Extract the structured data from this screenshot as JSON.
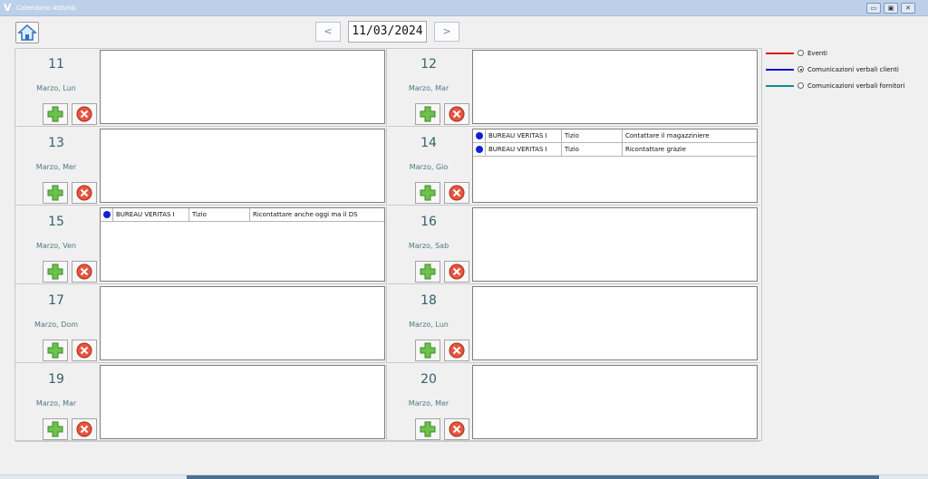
{
  "window": {
    "title": "Calendario Attività"
  },
  "toolbar": {
    "home_icon": "home-icon",
    "prev_label": "<",
    "next_label": ">",
    "date_value": "11/03/2024"
  },
  "days": [
    {
      "day": "11",
      "label": "Marzo, Lun",
      "events": []
    },
    {
      "day": "12",
      "label": "Marzo, Mar",
      "events": []
    },
    {
      "day": "13",
      "label": "Marzo, Mer",
      "events": []
    },
    {
      "day": "14",
      "label": "Marzo, Gio",
      "events": [
        {
          "client": "BUREAU VERITAS I",
          "user": "Tizio",
          "note": "Contattare il magazziniere"
        },
        {
          "client": "BUREAU VERITAS I",
          "user": "Tizio",
          "note": "Ricontattare grazie"
        }
      ]
    },
    {
      "day": "15",
      "label": "Marzo, Ven",
      "events": [
        {
          "client": "BUREAU VERITAS I",
          "user": "Tizio",
          "note": "Ricontattare anche oggi ma il DS"
        }
      ]
    },
    {
      "day": "16",
      "label": "Marzo, Sab",
      "events": []
    },
    {
      "day": "17",
      "label": "Marzo, Dom",
      "events": []
    },
    {
      "day": "18",
      "label": "Marzo, Lun",
      "events": []
    },
    {
      "day": "19",
      "label": "Marzo, Mar",
      "events": []
    },
    {
      "day": "20",
      "label": "Marzo, Mer",
      "events": []
    }
  ],
  "legend": [
    {
      "label": "Eventi",
      "color": "#e01010",
      "selected": false
    },
    {
      "label": "Comunicazioni verbali clienti",
      "color": "#1010d0",
      "selected": true
    },
    {
      "label": "Comunicazioni verbali fornitori",
      "color": "#138a8a",
      "selected": false
    }
  ],
  "colors": {
    "event_dot": "#1020d8",
    "day_text": "#35606a"
  }
}
